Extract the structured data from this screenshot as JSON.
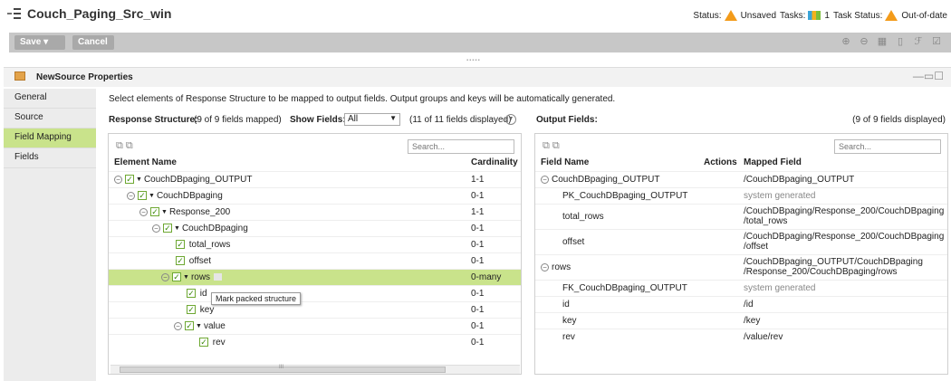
{
  "app": {
    "title": "Couch_Paging_Src_win"
  },
  "status": {
    "status_label": "Status:",
    "status_value": "Unsaved",
    "tasks_label": "Tasks:",
    "tasks_count": "1",
    "task_status_label": "Task Status:",
    "task_status_value": "Out-of-date"
  },
  "toolbar": {
    "save_label": "Save ▾",
    "cancel_label": "Cancel"
  },
  "properties": {
    "title": "NewSource Properties"
  },
  "sidebar": {
    "items": [
      {
        "label": "General"
      },
      {
        "label": "Source"
      },
      {
        "label": "Field Mapping"
      },
      {
        "label": "Fields"
      }
    ]
  },
  "info_text": "Select elements of Response Structure to be mapped to output fields. Output groups and keys will be automatically generated.",
  "response": {
    "label": "Response Structure:",
    "mapped": "(9 of 9 fields mapped)",
    "show_fields_label": "Show Fields:",
    "show_fields_value": "All",
    "displayed": "(11 of 11 fields displayed)"
  },
  "output": {
    "label": "Output Fields:",
    "displayed": "(9 of 9 fields displayed)"
  },
  "left_table": {
    "search_placeholder": "Search...",
    "col_element": "Element Name",
    "col_cardinality": "Cardinality",
    "rows": [
      {
        "name": "CouchDBpaging_OUTPUT",
        "card": "1-1"
      },
      {
        "name": "CouchDBpaging",
        "card": "0-1"
      },
      {
        "name": "Response_200",
        "card": "1-1"
      },
      {
        "name": "CouchDBpaging",
        "card": "0-1"
      },
      {
        "name": "total_rows",
        "card": "0-1"
      },
      {
        "name": "offset",
        "card": "0-1"
      },
      {
        "name": "rows",
        "card": "0-many"
      },
      {
        "name": "id",
        "card": "0-1"
      },
      {
        "name": "key",
        "card": "0-1"
      },
      {
        "name": "value",
        "card": "0-1"
      },
      {
        "name": "rev",
        "card": "0-1"
      }
    ],
    "tooltip": "Mark packed structure"
  },
  "right_table": {
    "search_placeholder": "Search...",
    "col_field": "Field Name",
    "col_actions": "Actions",
    "col_mapped": "Mapped Field",
    "rows": [
      {
        "name": "CouchDBpaging_OUTPUT",
        "mapped": "/CouchDBpaging_OUTPUT",
        "mapped2": ""
      },
      {
        "name": "PK_CouchDBpaging_OUTPUT",
        "mapped": "system generated",
        "mapped2": ""
      },
      {
        "name": "total_rows",
        "mapped": "/CouchDBpaging/Response_200/CouchDBpaging",
        "mapped2": "/total_rows"
      },
      {
        "name": "offset",
        "mapped": "/CouchDBpaging/Response_200/CouchDBpaging",
        "mapped2": "/offset"
      },
      {
        "name": "rows",
        "mapped": "/CouchDBpaging_OUTPUT/CouchDBpaging",
        "mapped2": "/Response_200/CouchDBpaging/rows"
      },
      {
        "name": "FK_CouchDBpaging_OUTPUT",
        "mapped": "system generated",
        "mapped2": ""
      },
      {
        "name": "id",
        "mapped": "/id",
        "mapped2": ""
      },
      {
        "name": "key",
        "mapped": "/key",
        "mapped2": ""
      },
      {
        "name": "rev",
        "mapped": "/value/rev",
        "mapped2": ""
      }
    ]
  },
  "scroll_label": "III"
}
